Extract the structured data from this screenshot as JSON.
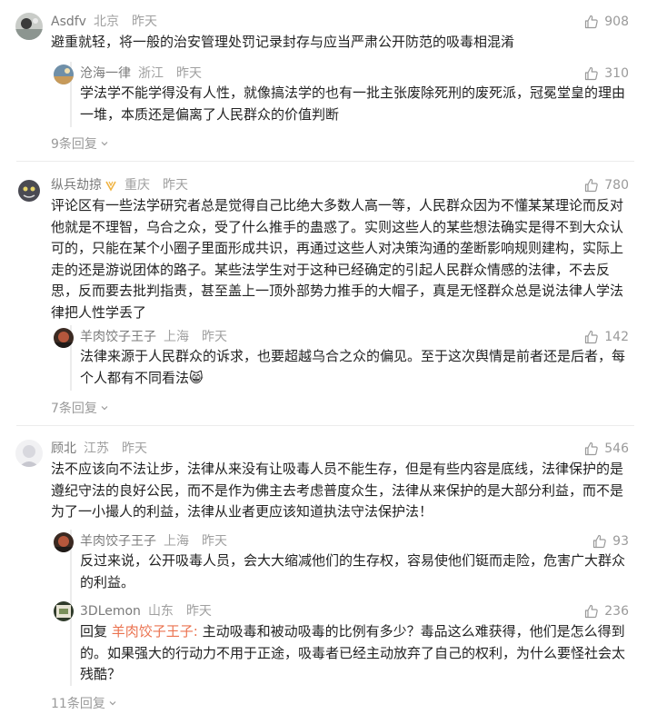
{
  "comments": [
    {
      "user": "Asdfv",
      "location": "北京",
      "time": "昨天",
      "likes": "908",
      "text": "避重就轻，将一般的治安管理处罚记录封存与应当严肃公开防范的吸毒相混淆",
      "replies": [
        {
          "user": "沧海一律",
          "location": "浙江",
          "time": "昨天",
          "likes": "310",
          "text": "学法学不能学得没有人性，就像搞法学的也有一批主张废除死刑的废死派，冠冕堂皇的理由一堆，本质还是偏离了人民群众的价值判断"
        }
      ],
      "more_replies": "9条回复"
    },
    {
      "user": "纵兵劫掠",
      "location": "重庆",
      "time": "昨天",
      "likes": "780",
      "text": "评论区有一些法学研究者总是觉得自己比绝大多数人高一等，人民群众因为不懂某某理论而反对他就是不理智，乌合之众，受了什么推手的蛊惑了。实则这些人的某些想法确实是得不到大众认可的，只能在某个小圈子里面形成共识，再通过这些人对决策沟通的垄断影响规则建构，实际上走的还是游说团体的路子。某些法学生对于这种已经确定的引起人民群众情感的法律，不去反思，反而要去批判指责，甚至盖上一顶外部势力推手的大帽子，真是无怪群众总是说法律人学法律把人性学丢了",
      "replies": [
        {
          "user": "羊肉饺子王子",
          "location": "上海",
          "time": "昨天",
          "likes": "142",
          "text": "法律来源于人民群众的诉求，也要超越乌合之众的偏见。至于这次舆情是前者还是后者，每个人都有不同看法😸"
        }
      ],
      "more_replies": "7条回复"
    },
    {
      "user": "顾北",
      "location": "江苏",
      "time": "昨天",
      "likes": "546",
      "text": "法不应该向不法让步，法律从来没有让吸毒人员不能生存，但是有些内容是底线，法律保护的是遵纪守法的良好公民，而不是作为佛主去考虑普度众生，法律从来保护的是大部分利益，而不是为了一小撮人的利益，法律从业者更应该知道执法守法保护法！",
      "replies": [
        {
          "user": "羊肉饺子王子",
          "location": "上海",
          "time": "昨天",
          "likes": "93",
          "text": "反过来说，公开吸毒人员，会大大缩减他们的生存权，容易使他们铤而走险，危害广大群众的利益。"
        },
        {
          "user": "3DLemon",
          "location": "山东",
          "time": "昨天",
          "likes": "236",
          "reply_prefix": "回复 ",
          "reply_to": "羊肉饺子王子:",
          "text": " 主动吸毒和被动吸毒的比例有多少？毒品这么难获得，他们是怎么得到的。如果强大的行动力不用于正途，吸毒者已经主动放弃了自己的权利，为什么要怪社会太残酷？"
        }
      ],
      "more_replies": "11条回复"
    }
  ]
}
